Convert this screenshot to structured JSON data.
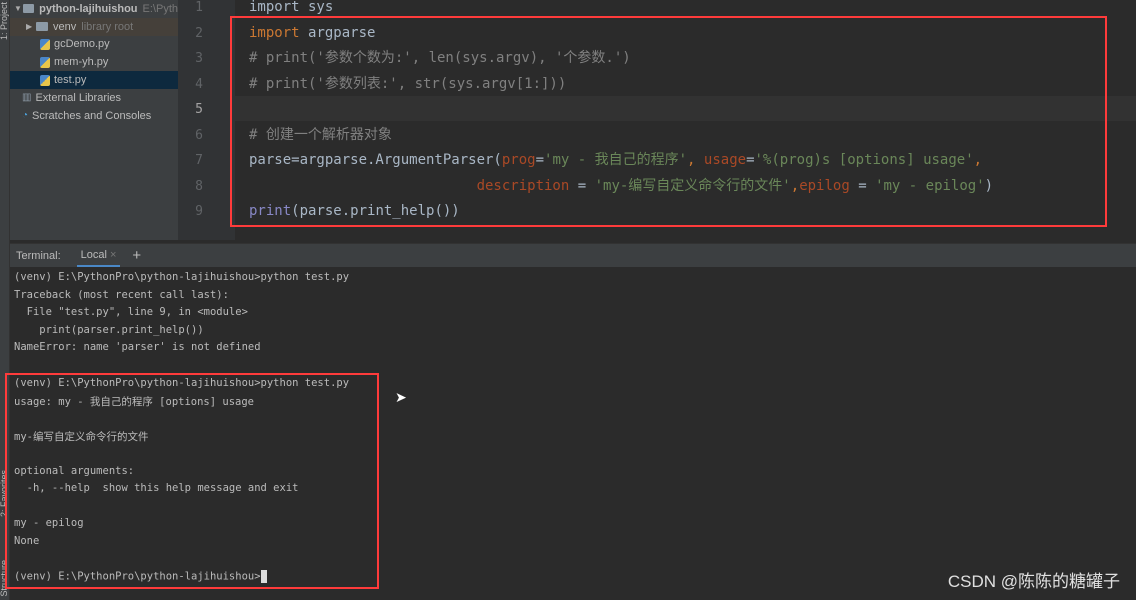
{
  "sidebar_tabs": {
    "project": "1: Project",
    "favorites": "2: Favorites",
    "structure": "Structure"
  },
  "project": {
    "root": {
      "name": "python-lajihuishou",
      "path": "E:\\Pyth"
    },
    "items": [
      {
        "name": "venv",
        "note": "library root",
        "type": "folder"
      },
      {
        "name": "gcDemo.py",
        "type": "python"
      },
      {
        "name": "mem-yh.py",
        "type": "python"
      },
      {
        "name": "test.py",
        "type": "python",
        "selected": true
      }
    ],
    "external": "External Libraries",
    "scratches": "Scratches and Consoles"
  },
  "editor": {
    "line_numbers": [
      "1",
      "2",
      "3",
      "4",
      "5",
      "6",
      "7",
      "8",
      "9"
    ],
    "current_line": 5,
    "lines": [
      [
        [
          "tx",
          "import sys"
        ]
      ],
      [
        [
          "kw",
          "import "
        ],
        [
          "tx",
          "argparse"
        ]
      ],
      [
        [
          "cm",
          "# print('参数个数为:', len(sys.argv), '个参数.')"
        ]
      ],
      [
        [
          "cm",
          "# print('参数列表:', str(sys.argv[1:]))"
        ]
      ],
      [],
      [
        [
          "cm",
          "# 创建一个解析器对象"
        ]
      ],
      [
        [
          "tx",
          "parse=argparse.ArgumentParser("
        ],
        [
          "par",
          "prog"
        ],
        [
          "tx",
          "="
        ],
        [
          "str",
          "'my - 我自己的程序'"
        ],
        [
          "kw",
          ", "
        ],
        [
          "par",
          "usage"
        ],
        [
          "tx",
          "="
        ],
        [
          "str",
          "'%(prog)s [options] usage'"
        ],
        [
          "kw",
          ","
        ]
      ],
      [
        [
          "tx",
          "                           "
        ],
        [
          "par",
          "description"
        ],
        [
          "tx",
          " = "
        ],
        [
          "str",
          "'my-编写自定义命令行的文件'"
        ],
        [
          "kw",
          ","
        ],
        [
          "par",
          "epilog"
        ],
        [
          "tx",
          " = "
        ],
        [
          "str",
          "'my - epilog'"
        ],
        [
          "tx",
          ")"
        ]
      ],
      [
        [
          "bi",
          "print"
        ],
        [
          "tx",
          "(parse.print_help())"
        ]
      ]
    ]
  },
  "terminal": {
    "label": "Terminal:",
    "tab": "Local",
    "add": "+",
    "lines": [
      "(venv) E:\\PythonPro\\python-lajihuishou>python test.py",
      "Traceback (most recent call last):",
      "  File \"test.py\", line 9, in <module>",
      "    print(parser.print_help())",
      "NameError: name 'parser' is not defined",
      "",
      "(venv) E:\\PythonPro\\python-lajihuishou>python test.py",
      "usage: my - 我自己的程序 [options] usage",
      "",
      "my-编写自定义命令行的文件",
      "",
      "optional arguments:",
      "  -h, --help  show this help message and exit",
      "",
      "my - epilog",
      "None",
      "",
      "(venv) E:\\PythonPro\\python-lajihuishou>"
    ]
  },
  "watermark": "CSDN @陈陈的糖罐子",
  "colors": {
    "highlight_box": "#ff3b3b",
    "keyword": "#cc7832",
    "string": "#6a8759",
    "comment": "#808080",
    "param": "#aa4926"
  }
}
